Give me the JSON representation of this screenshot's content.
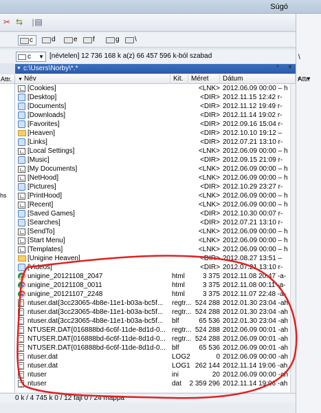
{
  "menu": {
    "help": "Súgó"
  },
  "drives": [
    {
      "letter": "c",
      "selected": true
    },
    {
      "letter": "d",
      "selected": false
    },
    {
      "letter": "e",
      "selected": false
    },
    {
      "letter": "f",
      "selected": false
    },
    {
      "letter": "g",
      "selected": false
    },
    {
      "letter": "\\",
      "selected": false
    }
  ],
  "drive_combo": {
    "value": "c"
  },
  "drive_info": "[névtelen]  12 736 168 k a(z) 66 457 596 k-ból szabad",
  "path": "c:\\Users\\Norby\\*.*",
  "columns": {
    "name": "Név",
    "ext": "Kit.",
    "size": "Méret",
    "date": "Dátum",
    "attr": "Attr."
  },
  "left_panel": {
    "header": "Attr.",
    "rows": [
      "",
      "",
      "",
      "",
      "",
      "",
      "",
      "",
      "",
      "",
      "",
      "",
      "hs",
      "",
      "",
      "",
      "",
      "",
      "",
      "",
      ""
    ]
  },
  "files": [
    {
      "icon": "dir-link",
      "name": "[Cookies]",
      "ext": "",
      "size": "<LNK>",
      "date": "2012.06.09 00:00 – h"
    },
    {
      "icon": "dir-special",
      "name": "[Desktop]",
      "ext": "",
      "size": "<DIR>",
      "date": "2012.11.15 12:42 r-"
    },
    {
      "icon": "dir-special",
      "name": "[Documents]",
      "ext": "",
      "size": "<DIR>",
      "date": "2012.11.12 19:49 r-"
    },
    {
      "icon": "dir-special",
      "name": "[Downloads]",
      "ext": "",
      "size": "<DIR>",
      "date": "2012.11.14 19:02 r-"
    },
    {
      "icon": "dir-special",
      "name": "[Favorites]",
      "ext": "",
      "size": "<DIR>",
      "date": "2012.09.16 15:04 r-"
    },
    {
      "icon": "folder",
      "name": "[Heaven]",
      "ext": "",
      "size": "<DIR>",
      "date": "2012.10.10 19:12 –"
    },
    {
      "icon": "dir-special",
      "name": "[Links]",
      "ext": "",
      "size": "<DIR>",
      "date": "2012.07.21 13:10 r-"
    },
    {
      "icon": "dir-link",
      "name": "[Local Settings]",
      "ext": "",
      "size": "<LNK>",
      "date": "2012.06.09 00:00 – h"
    },
    {
      "icon": "dir-special",
      "name": "[Music]",
      "ext": "",
      "size": "<DIR>",
      "date": "2012.09.15 21:09 r-"
    },
    {
      "icon": "dir-link",
      "name": "[My Documents]",
      "ext": "",
      "size": "<LNK>",
      "date": "2012.06.09 00:00 – h"
    },
    {
      "icon": "dir-link",
      "name": "[NetHood]",
      "ext": "",
      "size": "<LNK>",
      "date": "2012.06.09 00:00 – h"
    },
    {
      "icon": "dir-special",
      "name": "[Pictures]",
      "ext": "",
      "size": "<DIR>",
      "date": "2012.10.29 23:27 r-"
    },
    {
      "icon": "dir-link",
      "name": "[PrintHood]",
      "ext": "",
      "size": "<LNK>",
      "date": "2012.06.09 00:00 – h"
    },
    {
      "icon": "dir-link",
      "name": "[Recent]",
      "ext": "",
      "size": "<LNK>",
      "date": "2012.06.09 00:00 – h"
    },
    {
      "icon": "dir-special",
      "name": "[Saved Games]",
      "ext": "",
      "size": "<DIR>",
      "date": "2012.10.30 00:07 r-"
    },
    {
      "icon": "dir-special",
      "name": "[Searches]",
      "ext": "",
      "size": "<DIR>",
      "date": "2012.07.21 13:10 r-"
    },
    {
      "icon": "dir-link",
      "name": "[SendTo]",
      "ext": "",
      "size": "<LNK>",
      "date": "2012.06.09 00:00 – h"
    },
    {
      "icon": "dir-link",
      "name": "[Start Menu]",
      "ext": "",
      "size": "<LNK>",
      "date": "2012.06.09 00:00 – h"
    },
    {
      "icon": "dir-link",
      "name": "[Templates]",
      "ext": "",
      "size": "<LNK>",
      "date": "2012.06.09 00:00 – h"
    },
    {
      "icon": "folder",
      "name": "[Unigine Heaven]",
      "ext": "",
      "size": "<DIR>",
      "date": "2012.08.27 13:51 –"
    },
    {
      "icon": "dir-special",
      "name": "[Videos]",
      "ext": "",
      "size": "<DIR>",
      "date": "2012.07.21 13:10 r-"
    },
    {
      "icon": "chrome",
      "name": "unigine_20121108_2047",
      "ext": "html",
      "size": "3 375",
      "date": "2012.11.08 20:47 -a-"
    },
    {
      "icon": "chrome",
      "name": "unigine_20121108_0011",
      "ext": "html",
      "size": "3 375",
      "date": "2012.11.08 00:11 -a-"
    },
    {
      "icon": "chrome",
      "name": "unigine_20121107_2248",
      "ext": "html",
      "size": "3 375",
      "date": "2012.11.07 22:48 -a-"
    },
    {
      "icon": "file",
      "name": "ntuser.dat{3cc23065-4b8e-11e1-b03a-bc5f...",
      "ext": "regtr...",
      "size": "524 288",
      "date": "2012.01.30 23:04 -ah"
    },
    {
      "icon": "file",
      "name": "ntuser.dat{3cc23065-4b8e-11e1-b03a-bc5f...",
      "ext": "regtr...",
      "size": "524 288",
      "date": "2012.01.30 23:04 -ah"
    },
    {
      "icon": "file",
      "name": "ntuser.dat{3cc23065-4b8e-11e1-b03a-bc5f...",
      "ext": "blf",
      "size": "65 536",
      "date": "2012.01.30 23:04 -ah"
    },
    {
      "icon": "file",
      "name": "NTUSER.DAT{016888bd-6c6f-11de-8d1d-0...",
      "ext": "regtr...",
      "size": "524 288",
      "date": "2012.06.09 00:01 -ah"
    },
    {
      "icon": "file",
      "name": "NTUSER.DAT{016888bd-6c6f-11de-8d1d-0...",
      "ext": "regtr...",
      "size": "524 288",
      "date": "2012.06.09 00:01 -ah"
    },
    {
      "icon": "file",
      "name": "NTUSER.DAT{016888bd-6c6f-11de-8d1d-0...",
      "ext": "blf",
      "size": "65 536",
      "date": "2012.06.09 00:01 -ah"
    },
    {
      "icon": "file",
      "name": "ntuser.dat",
      "ext": "LOG2",
      "size": "0",
      "date": "2012.06.09 00:00 -ah"
    },
    {
      "icon": "file",
      "name": "ntuser.dat",
      "ext": "LOG1",
      "size": "262 144",
      "date": "2012.11.14 19:06 -ah"
    },
    {
      "icon": "file",
      "name": "ntuser",
      "ext": "ini",
      "size": "20",
      "date": "2012.06.09 00:00 -ah"
    },
    {
      "icon": "file",
      "name": "ntuser",
      "ext": "dat",
      "size": "2 359 296",
      "date": "2012.11.14 19:06 -ah"
    }
  ],
  "status": "0 k / 4 745 k   0 / 12 fájl   0 / 24 mappa",
  "right_pane": {
    "slash": "\\",
    "asterisk": "*",
    "attr": "Attr."
  },
  "colors": {
    "path_bar": "#2c5aa8",
    "annotation": "#e02020"
  }
}
